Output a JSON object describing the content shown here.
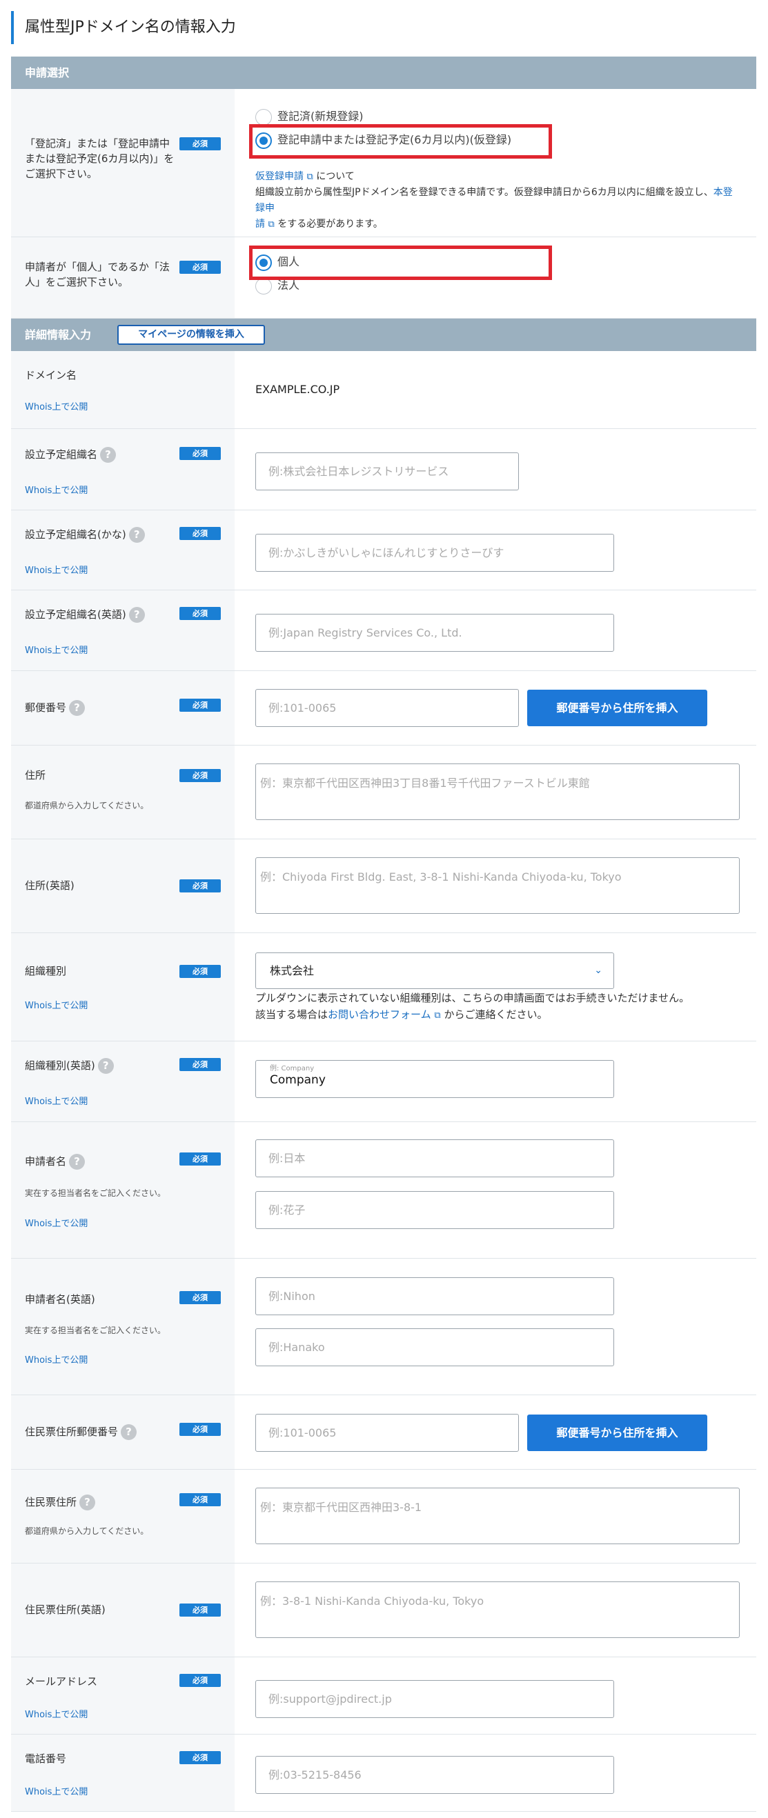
{
  "page_title": "属性型JPドメイン名の情報入力",
  "sections": {
    "application": "申請選択",
    "details": "詳細情報入力",
    "mypage_button": "マイページの情報を挿入"
  },
  "common": {
    "required": "必須",
    "whois": "Whois上で公開",
    "zip_button": "郵便番号から住所を挿入",
    "help": "?",
    "prefecture_hint": "都道府県から入力してください。",
    "real_person_hint": "実在する担当者名をご記入ください。"
  },
  "registration_status": {
    "label": "「登記済」または「登記申請中または登記予定(6カ月以内)」をご選択下さい。",
    "options": [
      "登記済(新規登録)",
      "登記申請中または登記予定(6カ月以内)(仮登録)"
    ],
    "selected": 1,
    "note_link": "仮登録申請",
    "note_about": "について",
    "note_line2": "組織設立前から属性型JPドメイン名を登録できる申請です。仮登録申請日から6カ月以内に組織を設立し、",
    "note_link2": "本登録申",
    "note_link3": "請",
    "note_line3_tail": "をする必要があります。"
  },
  "applicant_type": {
    "label": "申請者が「個人」であるか「法人」をご選択下さい。",
    "options": [
      "個人",
      "法人"
    ],
    "selected": 0
  },
  "domain": {
    "label": "ドメイン名",
    "value": "EXAMPLE.CO.JP"
  },
  "org_name": {
    "label": "設立予定組織名",
    "placeholder": "例:株式会社日本レジストリサービス"
  },
  "org_name_kana": {
    "label": "設立予定組織名(かな)",
    "placeholder": "例:かぶしきがいしゃにほんれじすとりさーびす"
  },
  "org_name_en": {
    "label": "設立予定組織名(英語)",
    "placeholder": "例:Japan Registry Services Co., Ltd."
  },
  "postal_code": {
    "label": "郵便番号",
    "placeholder": "例:101-0065"
  },
  "address": {
    "label": "住所",
    "placeholder": "例：東京都千代田区西神田3丁目8番1号千代田ファーストビル東館"
  },
  "address_en": {
    "label": "住所(英語)",
    "placeholder": "例：Chiyoda First Bldg. East, 3-8-1 Nishi-Kanda Chiyoda-ku, Tokyo"
  },
  "org_type": {
    "label": "組織種別",
    "selected": "株式会社",
    "note_line1": "プルダウンに表示されていない組織種別は、こちらの申請画面ではお手続きいただけません。",
    "note_pre": "該当する場合は",
    "note_link": "お問い合わせフォーム",
    "note_post": "からご連絡ください。"
  },
  "org_type_en": {
    "label": "組織種別(英語)",
    "float_label": "例: Company",
    "value": "Company"
  },
  "applicant_name": {
    "label": "申請者名",
    "placeholder_last": "例:日本",
    "placeholder_first": "例:花子"
  },
  "applicant_name_en": {
    "label": "申請者名(英語)",
    "placeholder_last": "例:Nihon",
    "placeholder_first": "例:Hanako"
  },
  "resident_postal": {
    "label": "住民票住所郵便番号",
    "placeholder": "例:101-0065"
  },
  "resident_address": {
    "label": "住民票住所",
    "placeholder": "例：東京都千代田区西神田3-8-1"
  },
  "resident_address_en": {
    "label": "住民票住所(英語)",
    "placeholder": "例：3-8-1 Nishi-Kanda Chiyoda-ku, Tokyo"
  },
  "email": {
    "label": "メールアドレス",
    "placeholder": "例:support@jpdirect.jp"
  },
  "phone": {
    "label": "電話番号",
    "placeholder": "例:03-5215-8456"
  }
}
